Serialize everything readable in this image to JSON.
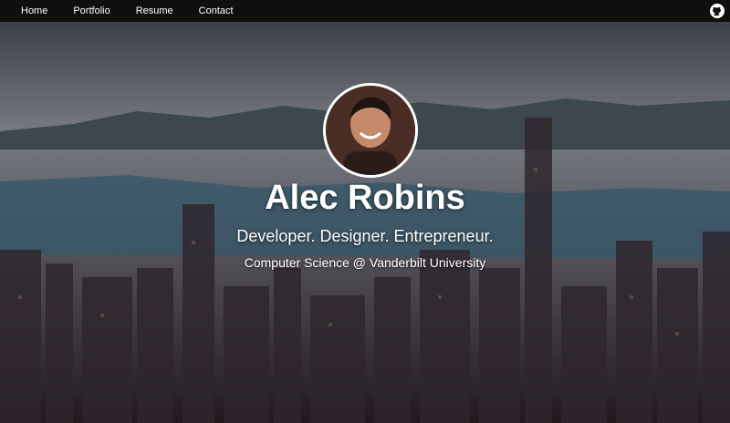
{
  "nav": {
    "items": [
      {
        "label": "Home"
      },
      {
        "label": "Portfolio"
      },
      {
        "label": "Resume"
      },
      {
        "label": "Contact"
      }
    ],
    "github_icon": "github-icon"
  },
  "hero": {
    "name": "Alec Robins",
    "tagline": "Developer. Designer. Entrepreneur.",
    "subtitle": "Computer Science @ Vanderbilt University",
    "background": "city-skyline-image",
    "avatar": "profile-photo"
  },
  "colors": {
    "navbar_bg": "#0f0f0f",
    "text": "#ffffff",
    "avatar_border": "#ffffff"
  }
}
